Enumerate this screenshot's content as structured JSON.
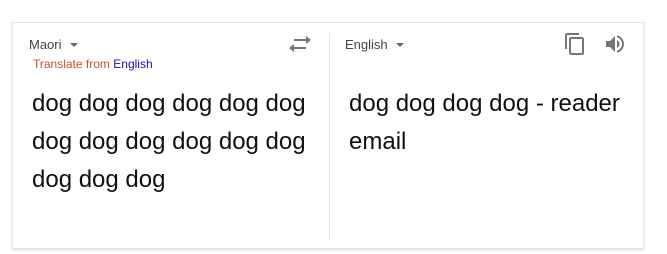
{
  "source": {
    "language": "Maori",
    "translate_from_prefix": "Translate from",
    "translate_from_language": "English",
    "text": "dog dog dog dog dog dog dog dog dog dog dog dog dog dog dog"
  },
  "target": {
    "language": "English",
    "text": "dog dog dog dog - reader email"
  },
  "icons": {
    "swap": "swap-languages-icon",
    "copy": "copy-icon",
    "speaker": "speaker-icon"
  },
  "colors": {
    "translate_from_prefix": "#c5502f",
    "translate_from_link": "#1a0dab",
    "icon_gray": "#757575"
  }
}
